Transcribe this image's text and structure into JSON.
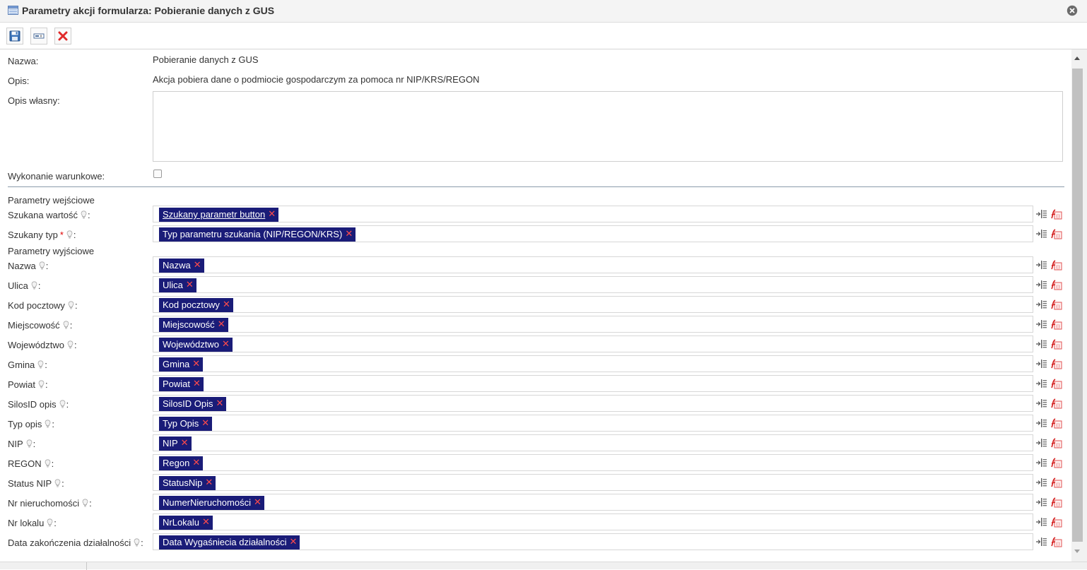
{
  "window": {
    "title": "Parametry akcji formularza: Pobieranie danych z GUS"
  },
  "toolbar": {
    "buttons": [
      "save-icon",
      "text-field-icon",
      "delete-icon"
    ]
  },
  "form": {
    "nazwa_label": "Nazwa:",
    "nazwa_value": "Pobieranie danych z GUS",
    "opis_label": "Opis:",
    "opis_value": "Akcja pobiera dane o podmiocie gospodarczym za pomoca nr NIP/KRS/REGON",
    "opis_wlasny_label": "Opis własny:",
    "opis_wlasny_value": "",
    "wykonanie_label": "Wykonanie warunkowe:",
    "wykonanie_checked": false
  },
  "inputs_section": {
    "heading": "Parametry wejściowe",
    "rows": [
      {
        "label": "Szukana wartość",
        "required": false,
        "chip": "Szukany parametr button",
        "link": true
      },
      {
        "label": "Szukany typ",
        "required": true,
        "chip": "Typ parametru szukania (NIP/REGON/KRS)",
        "link": false
      }
    ]
  },
  "outputs_section": {
    "heading": "Parametry wyjściowe",
    "rows": [
      {
        "label": "Nazwa",
        "chip": "Nazwa"
      },
      {
        "label": "Ulica",
        "chip": "Ulica"
      },
      {
        "label": "Kod pocztowy",
        "chip": "Kod pocztowy"
      },
      {
        "label": "Miejscowość",
        "chip": "Miejscowość"
      },
      {
        "label": "Województwo",
        "chip": "Województwo"
      },
      {
        "label": "Gmina",
        "chip": "Gmina"
      },
      {
        "label": "Powiat",
        "chip": "Powiat"
      },
      {
        "label": "SilosID opis",
        "chip": "SilosID Opis"
      },
      {
        "label": "Typ opis",
        "chip": "Typ Opis"
      },
      {
        "label": "NIP",
        "chip": "NIP"
      },
      {
        "label": "REGON",
        "chip": "Regon"
      },
      {
        "label": "Status NIP",
        "chip": "StatusNip"
      },
      {
        "label": "Nr nieruchomości",
        "chip": "NumerNieruchomości"
      },
      {
        "label": "Nr lokalu",
        "chip": "NrLokalu"
      },
      {
        "label": "Data zakończenia działalności",
        "chip": "Data Wygaśniecia działalności"
      }
    ]
  },
  "colors": {
    "chip_background": "#1a1c78",
    "chip_remove": "#ff4b4b",
    "required_star": "#e00000",
    "divider": "#8a9bab"
  }
}
